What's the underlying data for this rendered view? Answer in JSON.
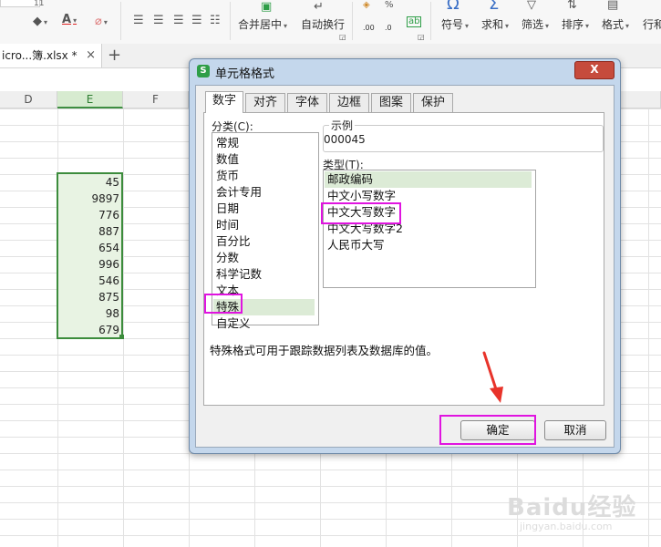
{
  "ribbon": {
    "font_size": "11",
    "merge_center": "合并居中",
    "wrap_text": "自动换行",
    "symbol": "符号",
    "sum": "求和",
    "filter": "筛选",
    "sort": "排序",
    "format": "格式",
    "rows_cols": "行和",
    "decimal_inc": ".00",
    "decimal_dec": ".0"
  },
  "file_tab": {
    "name": "icro...簿.xlsx *",
    "close": "×",
    "new_tab": "+"
  },
  "sheet": {
    "columns": [
      "D",
      "E",
      "F"
    ],
    "selected_column": "E",
    "e_values": [
      "45",
      "9897",
      "776",
      "887",
      "654",
      "996",
      "546",
      "875",
      "98",
      "679"
    ]
  },
  "dialog": {
    "title": "单元格格式",
    "logo": "S",
    "close": "X",
    "tabs": [
      "数字",
      "对齐",
      "字体",
      "边框",
      "图案",
      "保护"
    ],
    "active_tab": "数字",
    "category_label": "分类(C):",
    "categories": [
      "常规",
      "数值",
      "货币",
      "会计专用",
      "日期",
      "时间",
      "百分比",
      "分数",
      "科学记数",
      "文本",
      "特殊",
      "自定义"
    ],
    "selected_category": "特殊",
    "sample_label": "示例",
    "sample_value": "000045",
    "type_label": "类型(T):",
    "types": [
      "邮政编码",
      "中文小写数字",
      "中文大写数字",
      "中文大写数字2",
      "人民币大写"
    ],
    "selected_type": "邮政编码",
    "highlighted_type": "中文大写数字",
    "description": "特殊格式可用于跟踪数据列表及数据库的值。",
    "ok_label": "确定",
    "cancel_label": "取消"
  },
  "colors": {
    "accent_green": "#3c8c3c",
    "annotation_magenta": "#e014e0",
    "arrow_red": "#e8332a",
    "dialog_frame": "#c4d7ec",
    "close_red": "#c64b3c"
  },
  "watermark": {
    "main": "Baidu经验",
    "sub": "jingyan.baidu.com"
  }
}
